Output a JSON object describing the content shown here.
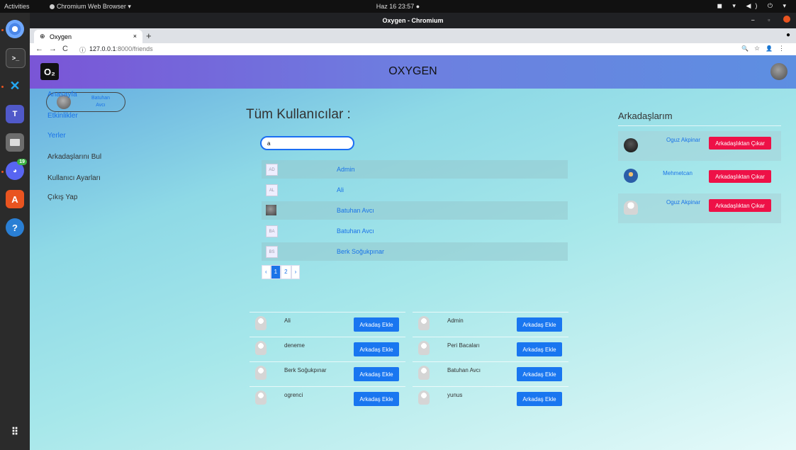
{
  "os": {
    "activities": "Activities",
    "app_menu": "Chromium Web Browser ▾",
    "clock": "Haz 16 23:57 ●",
    "tray": "◼ ▾ ◀) ⏻ ▾",
    "dock_badge": "19"
  },
  "browser": {
    "window_title": "Oxygen - Chromium",
    "window_controls": "– ▫",
    "tab_title": "Oxygen",
    "tab_close": "×",
    "new_tab": "+",
    "back": "←",
    "forward": "→",
    "reload": "C",
    "url_host": "127.0.0.1",
    "url_path": ":8000/friends",
    "info_icon": "ⓘ",
    "zoom_icon": "🔍",
    "star_icon": "☆",
    "profile_icon": "👤",
    "menu_icon": "⋮",
    "tab_menu": "●"
  },
  "navbar": {
    "logo": "O₂",
    "brand": "OXYGEN"
  },
  "sidebar": {
    "user_name": "Batuhan Avcı",
    "links": [
      {
        "label": "Anasayfa",
        "color": "#1a73e8"
      },
      {
        "label": "Etkinlikler",
        "color": "#1a73e8"
      },
      {
        "label": "Yerler",
        "color": "#1a73e8"
      },
      {
        "label": "Arkadaşlarını Bul",
        "color": "#333333"
      },
      {
        "label": "Kullanıcı Ayarları",
        "color": "#333333"
      },
      {
        "label": "Çıkış Yap",
        "color": "#333333"
      }
    ]
  },
  "main": {
    "title": "Tüm Kullanıcılar :",
    "search_value": "a",
    "users": [
      {
        "initials": "AD",
        "name": "Admin"
      },
      {
        "initials": "AL",
        "name": "Ali"
      },
      {
        "initials": "",
        "name": "Batuhan Avcı"
      },
      {
        "initials": "BA",
        "name": "Batuhan Avcı"
      },
      {
        "initials": "BS",
        "name": "Berk Soğukpınar"
      }
    ],
    "pagination": {
      "prev": "‹",
      "pages": [
        "1",
        "2"
      ],
      "next": "›",
      "current": "1"
    }
  },
  "suggestions": {
    "button_label": "Arkadaş Ekle",
    "left": [
      "Ali",
      "deneme",
      "Berk Soğukpınar",
      "ogrenci"
    ],
    "right": [
      "Admin",
      "Peri Bacaları",
      "Batuhan Avcı",
      "yunus"
    ]
  },
  "friends": {
    "title": "Arkadaşlarım",
    "remove_label": "Arkadaşlıktan Çıkar",
    "items": [
      "Oguz Akpinar",
      "Mehmetcan",
      "Oguz Akpinar"
    ]
  },
  "colors": {
    "primary_blue": "#1976f0",
    "danger_red": "#ee1147",
    "link_blue": "#1a73e8"
  }
}
